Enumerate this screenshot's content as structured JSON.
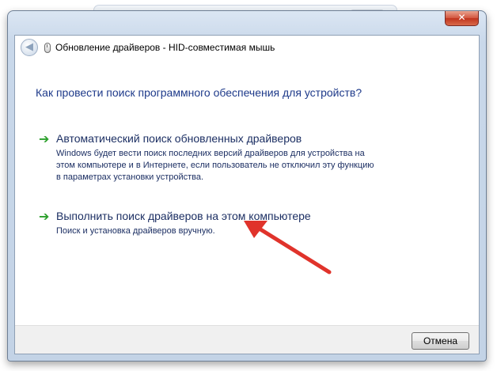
{
  "dialog": {
    "title": "Обновление драйверов - HID-совместимая мышь",
    "close_label": "✕"
  },
  "question": "Как провести поиск программного обеспечения для устройств?",
  "options": [
    {
      "title": "Автоматический поиск обновленных драйверов",
      "description": "Windows будет вести поиск последних версий драйверов для устройства на этом компьютере и в Интернете, если пользователь не отключил эту функцию в параметрах установки устройства."
    },
    {
      "title": "Выполнить поиск драйверов на этом компьютере",
      "description": "Поиск и установка драйверов вручную."
    }
  ],
  "footer": {
    "cancel_label": "Отмена"
  },
  "icons": {
    "back": "back-arrow-icon",
    "device": "mouse-device-icon",
    "option_arrow": "green-arrow-icon"
  },
  "colors": {
    "link_blue": "#1c2f63",
    "heading_blue": "#1e3a8a",
    "annotation_red": "#e0332b",
    "arrow_green": "#2ca02c"
  }
}
